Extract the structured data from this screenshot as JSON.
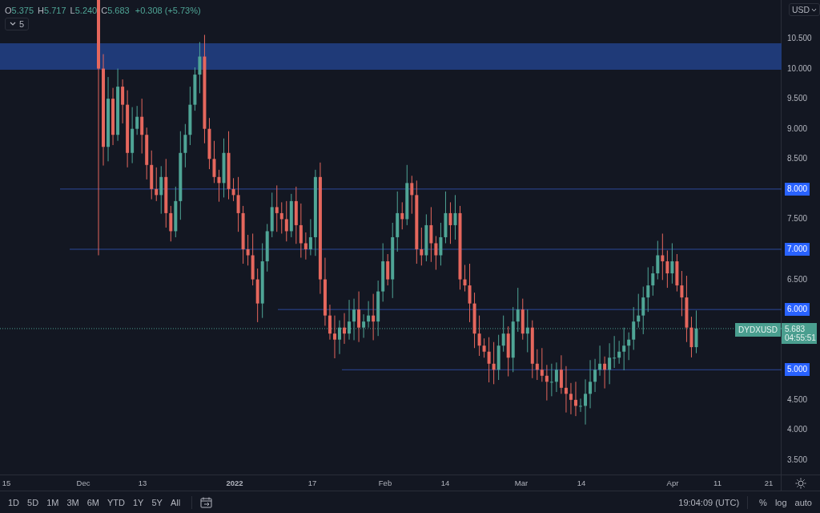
{
  "legend": {
    "ohlc": [
      {
        "label": "O",
        "value": "5.375"
      },
      {
        "label": "H",
        "value": "5.717"
      },
      {
        "label": "L",
        "value": "5.240"
      },
      {
        "label": "C",
        "value": "5.683"
      }
    ],
    "change": "+0.308 (+5.73%)",
    "indicators_toggle": "5"
  },
  "price_axis": {
    "currency": "USD",
    "ticks": [
      {
        "label": "10.500",
        "highlighted": false
      },
      {
        "label": "10.000",
        "highlighted": false
      },
      {
        "label": "9.500",
        "highlighted": false
      },
      {
        "label": "9.000",
        "highlighted": false
      },
      {
        "label": "8.500",
        "highlighted": false
      },
      {
        "label": "8.000",
        "highlighted": true
      },
      {
        "label": "7.500",
        "highlighted": false
      },
      {
        "label": "7.000",
        "highlighted": true
      },
      {
        "label": "6.500",
        "highlighted": false
      },
      {
        "label": "6.000",
        "highlighted": true
      },
      {
        "label": "5.000",
        "highlighted": true
      },
      {
        "label": "4.500",
        "highlighted": false
      },
      {
        "label": "4.000",
        "highlighted": false
      },
      {
        "label": "3.500",
        "highlighted": false
      }
    ],
    "symbol_tag": "DYDXUSD",
    "last_price": "5.683",
    "countdown": "04:55:51"
  },
  "time_axis": [
    {
      "label": "15",
      "kind": "day"
    },
    {
      "label": "Dec",
      "kind": "month"
    },
    {
      "label": "13",
      "kind": "day"
    },
    {
      "label": "2022",
      "kind": "year"
    },
    {
      "label": "17",
      "kind": "day"
    },
    {
      "label": "Feb",
      "kind": "month"
    },
    {
      "label": "14",
      "kind": "day"
    },
    {
      "label": "Mar",
      "kind": "month"
    },
    {
      "label": "14",
      "kind": "day"
    },
    {
      "label": "Apr",
      "kind": "month"
    },
    {
      "label": "11",
      "kind": "day"
    },
    {
      "label": "21",
      "kind": "day"
    }
  ],
  "toolbar": {
    "ranges": [
      "1D",
      "5D",
      "1M",
      "3M",
      "6M",
      "YTD",
      "1Y",
      "5Y",
      "All"
    ],
    "clock": "19:04:09 (UTC)",
    "options": [
      "%",
      "log",
      "auto"
    ]
  }
}
